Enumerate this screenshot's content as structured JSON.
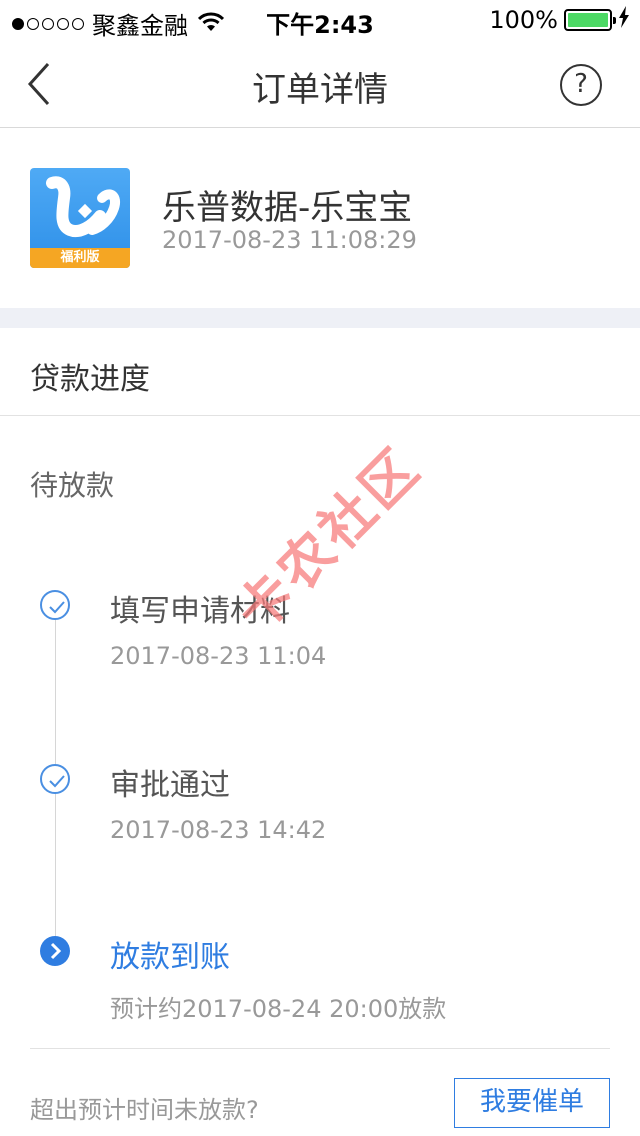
{
  "status_bar": {
    "carrier": "聚鑫金融",
    "time": "下午2:43",
    "battery": "100%",
    "signal_bars": 1
  },
  "nav": {
    "title": "订单详情",
    "help_label": "?"
  },
  "product": {
    "name": "乐普数据-乐宝宝",
    "time": "2017-08-23 11:08:29",
    "icon_badge": "福利版"
  },
  "progress": {
    "title": "贷款进度",
    "status": "待放款",
    "steps": [
      {
        "label": "填写申请材料",
        "time": "2017-08-23 11:04",
        "state": "done"
      },
      {
        "label": "审批通过",
        "time": "2017-08-23 14:42",
        "state": "done"
      },
      {
        "label": "放款到账",
        "time": "预计约2017-08-24 20:00放款",
        "state": "current"
      }
    ]
  },
  "footer": {
    "question": "超出预计时间未放款?",
    "urge_button": "我要催单"
  },
  "watermark": "卡农社区",
  "colors": {
    "accent": "#2f7de1",
    "battery": "#4cd964",
    "band": "#eef0f6",
    "watermark": "#f67878"
  }
}
